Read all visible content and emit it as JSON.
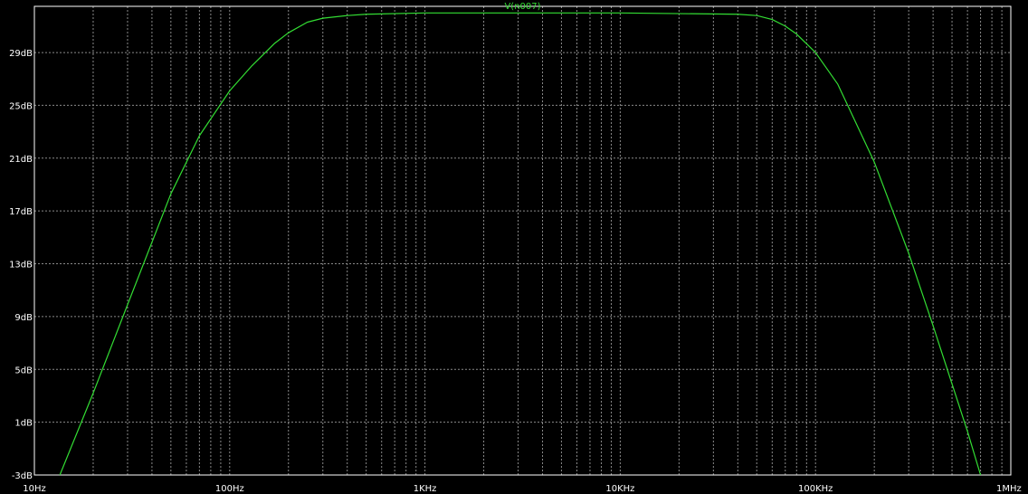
{
  "chart_data": {
    "type": "line",
    "title": "",
    "xlabel": "",
    "ylabel": "",
    "x_scale": "log",
    "xlim": [
      10,
      1000000
    ],
    "ylim": [
      -3,
      32.5
    ],
    "grid": true,
    "legend": "top-center",
    "x_ticks": [
      {
        "value": 10,
        "label": "10Hz"
      },
      {
        "value": 100,
        "label": "100Hz"
      },
      {
        "value": 1000,
        "label": "1KHz"
      },
      {
        "value": 10000,
        "label": "10KHz"
      },
      {
        "value": 100000,
        "label": "100KHz"
      },
      {
        "value": 1000000,
        "label": "1MHz"
      }
    ],
    "y_ticks": [
      {
        "value": -3,
        "label": "-3dB"
      },
      {
        "value": 1,
        "label": "1dB"
      },
      {
        "value": 5,
        "label": "5dB"
      },
      {
        "value": 9,
        "label": "9dB"
      },
      {
        "value": 13,
        "label": "13dB"
      },
      {
        "value": 17,
        "label": "17dB"
      },
      {
        "value": 21,
        "label": "21dB"
      },
      {
        "value": 25,
        "label": "25dB"
      },
      {
        "value": 29,
        "label": "29dB"
      }
    ],
    "series": [
      {
        "name": "V(n007)",
        "color": "#33dd33",
        "x": [
          13.5,
          20,
          30,
          50,
          70,
          100,
          130,
          170,
          200,
          250,
          300,
          400,
          500,
          1000,
          10000,
          40000,
          50000,
          60000,
          70000,
          80000,
          100000,
          130000,
          200000,
          300000,
          400000,
          500000,
          600000,
          700000
        ],
        "y": [
          -3.0,
          3.2,
          9.9,
          18.3,
          22.7,
          26.1,
          28.0,
          29.7,
          30.5,
          31.3,
          31.6,
          31.8,
          31.9,
          32.0,
          32.0,
          31.9,
          31.8,
          31.5,
          31.0,
          30.4,
          29.0,
          26.6,
          20.7,
          13.8,
          8.3,
          3.9,
          0.3,
          -3.0
        ]
      }
    ]
  },
  "colors": {
    "background": "#000000",
    "grid": "#8a8a8a",
    "axis": "#ffffff",
    "tick_label": "#ffffff",
    "trace": "#33dd33"
  }
}
